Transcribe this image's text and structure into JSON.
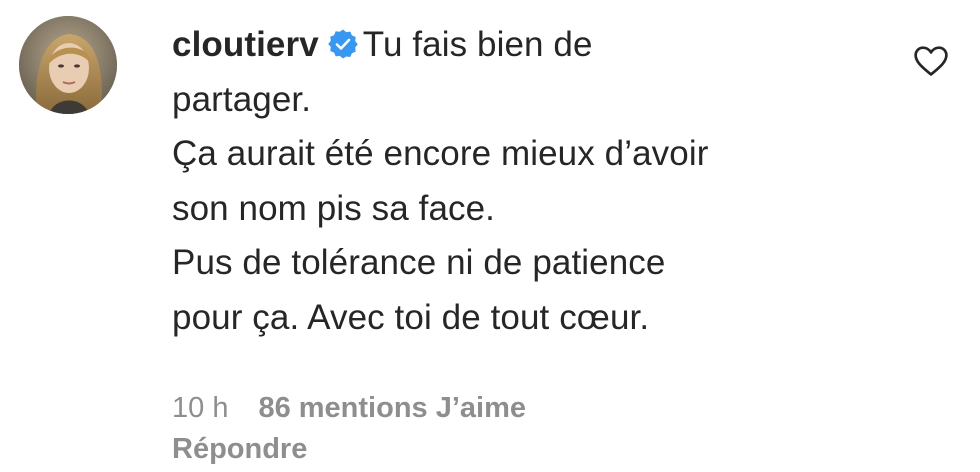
{
  "comment": {
    "username": "cloutierv",
    "verified_icon": "verified-badge-icon",
    "lines": [
      "Tu fais bien de",
      "partager.",
      "Ça aurait été encore mieux d’avoir",
      "son nom pis sa face.",
      "Pus de tolérance ni de patience",
      "pour ça. Avec toi de tout cœur."
    ],
    "time": "10 h",
    "likes": "86 mentions J’aime",
    "reply": "Répondre",
    "like_icon": "heart-outline-icon"
  },
  "colors": {
    "text": "#262626",
    "muted": "#8e8e8e",
    "verified": "#3897f0"
  }
}
